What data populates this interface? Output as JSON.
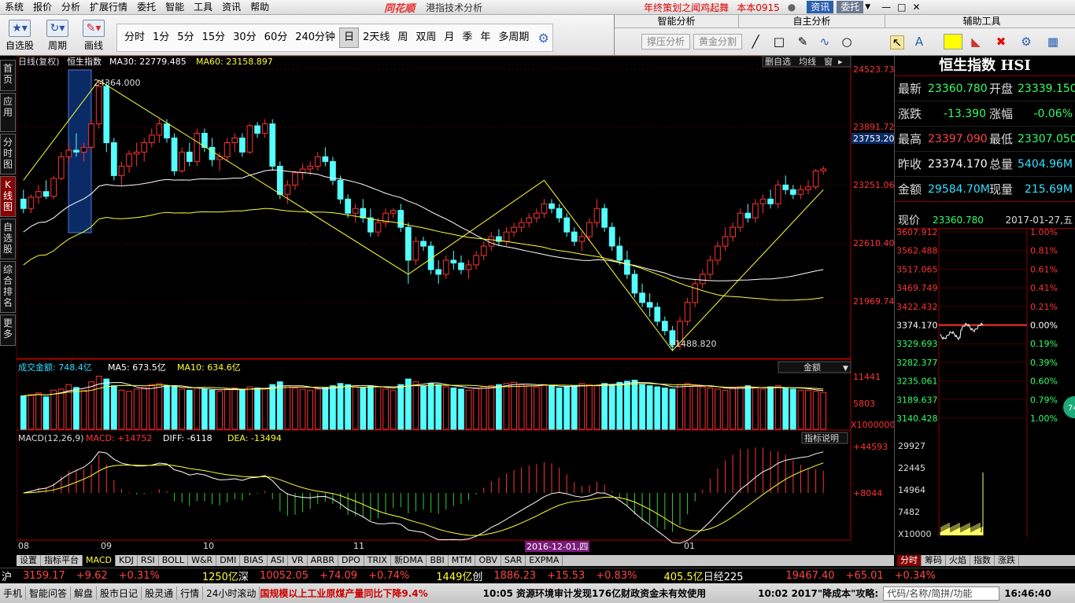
{
  "menu": {
    "items": [
      "系统",
      "报价",
      "分析",
      "扩展行情",
      "委托",
      "智能",
      "工具",
      "资讯",
      "帮助"
    ],
    "logo": "同花顺",
    "title": "港指技术分析",
    "promo": "年终策划之闻鸡起舞",
    "user": "本本0915",
    "btn_info": "资讯",
    "btn_trade": "委托"
  },
  "toolbar": {
    "btn_selfselect": "自选股",
    "btn_cycle": "周期",
    "btn_draw": "画线",
    "periods": [
      "分时",
      "1分",
      "5分",
      "15分",
      "30分",
      "60分",
      "240分钟",
      "日",
      "2天线",
      "周",
      "双周",
      "月",
      "季",
      "年",
      "多周期"
    ],
    "active_period": "日"
  },
  "smart": {
    "title_smart": "智能分析",
    "title_self": "自主分析",
    "title_aux": "辅助工具",
    "btn_pressure": "撑压分析",
    "btn_gold": "黄金分割"
  },
  "leftnav": [
    "首页",
    "应用",
    "分时图",
    "K线图",
    "自选股",
    "综合排名",
    "更多"
  ],
  "chart": {
    "header": {
      "period": "日线(复权)",
      "name": "恒生指数",
      "ma30_label": "MA30: 22779.485",
      "ma60_label": "MA60: 23158.897"
    },
    "buttons": [
      "删自选",
      "均线",
      "窗"
    ],
    "price_axis": [
      "24523.73",
      "23891.72",
      "23753.20",
      "23251.06",
      "22610.40",
      "21969.74"
    ],
    "annot_high": "24364.000",
    "annot_low": "21488.820",
    "vol_header": {
      "label": "成交金额: 748.4亿",
      "ma5": "MA5: 673.5亿",
      "ma10": "MA10: 634.6亿"
    },
    "vol_select": "金额",
    "vol_axis": [
      "11441",
      "5803",
      "X1000000"
    ],
    "macd_header": {
      "label": "MACD(12,26,9)",
      "macd": "MACD: +14752",
      "diff": "DIFF: -6118",
      "dea": "DEA: -13494"
    },
    "macd_btn": "指标说明",
    "macd_axis": [
      "+44593",
      "+8044"
    ],
    "x_labels": [
      "08",
      "09",
      "10",
      "11",
      "2016-12-01,四",
      "01"
    ]
  },
  "chart_data": {
    "type": "candlestick",
    "title": "恒生指数",
    "ohlc": [
      [
        23100,
        23200,
        22950,
        23000
      ],
      [
        23000,
        23150,
        22950,
        23120
      ],
      [
        23120,
        23250,
        23050,
        23180
      ],
      [
        23180,
        23300,
        23100,
        23130
      ],
      [
        23130,
        23350,
        23100,
        23320
      ],
      [
        23320,
        23600,
        23300,
        23550
      ],
      [
        23550,
        23700,
        23480,
        23620
      ],
      [
        23620,
        23800,
        23550,
        23600
      ],
      [
        23600,
        23700,
        23500,
        23650
      ],
      [
        23650,
        23950,
        23600,
        23900
      ],
      [
        23900,
        24364,
        23850,
        24300
      ],
      [
        24300,
        24350,
        23600,
        23700
      ],
      [
        23700,
        23750,
        23300,
        23350
      ],
      [
        23350,
        23500,
        23250,
        23450
      ],
      [
        23450,
        23620,
        23380,
        23580
      ],
      [
        23580,
        23700,
        23450,
        23600
      ],
      [
        23600,
        23750,
        23500,
        23700
      ],
      [
        23700,
        23850,
        23650,
        23780
      ],
      [
        23780,
        23950,
        23700,
        23900
      ],
      [
        23900,
        23950,
        23700,
        23750
      ],
      [
        23750,
        23800,
        23350,
        23400
      ],
      [
        23400,
        23650,
        23380,
        23600
      ],
      [
        23600,
        23700,
        23450,
        23500
      ],
      [
        23500,
        23850,
        23450,
        23800
      ],
      [
        23800,
        23850,
        23600,
        23650
      ],
      [
        23650,
        23750,
        23450,
        23520
      ],
      [
        23520,
        23600,
        23400,
        23550
      ],
      [
        23550,
        23750,
        23500,
        23700
      ],
      [
        23700,
        23800,
        23600,
        23750
      ],
      [
        23750,
        23800,
        23550,
        23600
      ],
      [
        23600,
        23900,
        23580,
        23880
      ],
      [
        23880,
        23920,
        23750,
        23800
      ],
      [
        23800,
        23950,
        23750,
        23900
      ],
      [
        23900,
        23950,
        23400,
        23450
      ],
      [
        23450,
        23500,
        23100,
        23150
      ],
      [
        23150,
        23300,
        23050,
        23250
      ],
      [
        23250,
        23400,
        23200,
        23380
      ],
      [
        23380,
        23480,
        23300,
        23420
      ],
      [
        23420,
        23500,
        23350,
        23450
      ],
      [
        23450,
        23600,
        23400,
        23550
      ],
      [
        23550,
        23650,
        23450,
        23500
      ],
      [
        23500,
        23550,
        23250,
        23300
      ],
      [
        23300,
        23350,
        23050,
        23100
      ],
      [
        23100,
        23150,
        22900,
        22950
      ],
      [
        22950,
        23050,
        22850,
        23000
      ],
      [
        23000,
        23100,
        22850,
        22900
      ],
      [
        22900,
        23000,
        22700,
        22750
      ],
      [
        22750,
        22900,
        22700,
        22850
      ],
      [
        22850,
        23000,
        22800,
        22950
      ],
      [
        22950,
        23000,
        22900,
        22980
      ],
      [
        22980,
        23050,
        22750,
        22800
      ],
      [
        22800,
        22850,
        22200,
        22450
      ],
      [
        22450,
        22700,
        22400,
        22650
      ],
      [
        22650,
        22700,
        22550,
        22600
      ],
      [
        22600,
        22650,
        22300,
        22350
      ],
      [
        22350,
        22450,
        22200,
        22300
      ],
      [
        22300,
        22500,
        22250,
        22450
      ],
      [
        22450,
        22550,
        22350,
        22420
      ],
      [
        22420,
        22500,
        22300,
        22350
      ],
      [
        22350,
        22450,
        22250,
        22400
      ],
      [
        22400,
        22550,
        22350,
        22500
      ],
      [
        22500,
        22650,
        22450,
        22600
      ],
      [
        22600,
        22750,
        22550,
        22700
      ],
      [
        22700,
        22780,
        22600,
        22650
      ],
      [
        22650,
        22800,
        22600,
        22750
      ],
      [
        22750,
        22850,
        22700,
        22800
      ],
      [
        22800,
        22900,
        22750,
        22850
      ],
      [
        22850,
        22950,
        22800,
        22900
      ],
      [
        22900,
        23000,
        22850,
        22950
      ],
      [
        22950,
        23100,
        22900,
        23050
      ],
      [
        23050,
        23100,
        22950,
        23000
      ],
      [
        23000,
        23050,
        22850,
        22900
      ],
      [
        22900,
        22950,
        22700,
        22750
      ],
      [
        22750,
        22800,
        22600,
        22650
      ],
      [
        22650,
        22750,
        22550,
        22700
      ],
      [
        22700,
        22900,
        22650,
        22850
      ],
      [
        22850,
        23100,
        22800,
        23000
      ],
      [
        23000,
        23050,
        22750,
        22800
      ],
      [
        22800,
        22850,
        22550,
        22600
      ],
      [
        22600,
        22700,
        22400,
        22450
      ],
      [
        22450,
        22550,
        22250,
        22300
      ],
      [
        22300,
        22350,
        22050,
        22100
      ],
      [
        22100,
        22200,
        21950,
        22000
      ],
      [
        22000,
        22100,
        21850,
        21950
      ],
      [
        21950,
        22000,
        21750,
        21800
      ],
      [
        21800,
        21850,
        21650,
        21700
      ],
      [
        21700,
        21750,
        21488,
        21550
      ],
      [
        21550,
        21850,
        21500,
        21800
      ],
      [
        21800,
        22050,
        21750,
        22000
      ],
      [
        22000,
        22250,
        21950,
        22200
      ],
      [
        22200,
        22350,
        22150,
        22300
      ],
      [
        22300,
        22500,
        22250,
        22450
      ],
      [
        22450,
        22650,
        22400,
        22600
      ],
      [
        22600,
        22800,
        22550,
        22700
      ],
      [
        22700,
        22850,
        22650,
        22800
      ],
      [
        22800,
        23000,
        22750,
        22950
      ],
      [
        22950,
        23050,
        22850,
        22900
      ],
      [
        22900,
        23100,
        22850,
        23050
      ],
      [
        23050,
        23150,
        22950,
        23100
      ],
      [
        23100,
        23200,
        23000,
        23050
      ],
      [
        23050,
        23300,
        23000,
        23250
      ],
      [
        23250,
        23350,
        23150,
        23200
      ],
      [
        23200,
        23250,
        23100,
        23150
      ],
      [
        23150,
        23250,
        23100,
        23200
      ],
      [
        23200,
        23300,
        23150,
        23230
      ],
      [
        23230,
        23420,
        23200,
        23400
      ],
      [
        23400,
        23450,
        23360,
        23420
      ]
    ],
    "volume": [
      60,
      62,
      65,
      58,
      70,
      72,
      80,
      75,
      70,
      85,
      95,
      90,
      78,
      70,
      68,
      72,
      75,
      80,
      82,
      78,
      76,
      72,
      70,
      74,
      72,
      70,
      68,
      72,
      74,
      70,
      76,
      74,
      72,
      80,
      85,
      78,
      74,
      72,
      70,
      72,
      74,
      78,
      82,
      80,
      76,
      74,
      78,
      76,
      72,
      70,
      80,
      90,
      85,
      78,
      82,
      80,
      76,
      74,
      72,
      70,
      74,
      76,
      78,
      80,
      82,
      84,
      80,
      78,
      76,
      80,
      78,
      74,
      76,
      78,
      82,
      80,
      78,
      82,
      80,
      84,
      86,
      88,
      80,
      78,
      76,
      74,
      72,
      80,
      82,
      78,
      76,
      74,
      72,
      70,
      74,
      76,
      78,
      74,
      72,
      76,
      78,
      74,
      72,
      70,
      70,
      68,
      66
    ],
    "ylim": [
      21488,
      24523.73
    ],
    "xlabels": [
      "08",
      "09",
      "10",
      "11",
      "2016-12-01,四",
      "01"
    ]
  },
  "quote": {
    "title": "恒生指数 HSI",
    "rows": [
      {
        "l": "最新",
        "v": "23360.780",
        "vc": "green",
        "l2": "开盘",
        "v2": "23339.150",
        "v2c": "green"
      },
      {
        "l": "涨跌",
        "v": "-13.390",
        "vc": "green",
        "l2": "涨幅",
        "v2": "-0.06%",
        "v2c": "green"
      },
      {
        "l": "最高",
        "v": "23397.090",
        "vc": "red",
        "l2": "最低",
        "v2": "23307.050",
        "v2c": "green"
      },
      {
        "l": "昨收",
        "v": "23374.170",
        "vc": "white",
        "l2": "总量",
        "v2": "5404.96M",
        "v2c": "cyan"
      },
      {
        "l": "金额",
        "v": "29584.70M",
        "vc": "cyan",
        "l2": "现量",
        "v2": "215.69M",
        "v2c": "cyan"
      }
    ],
    "now_label": "现价",
    "now_value": "23360.780",
    "date": "2017-01-27,五",
    "mini_left": [
      "3607.912",
      "3562.488",
      "3517.065",
      "3469.749",
      "3422.432",
      "3374.170",
      "3329.693",
      "3282.377",
      "3235.061",
      "3189.637",
      "3140.428"
    ],
    "mini_right": [
      "1.00%",
      "0.81%",
      "0.61%",
      "0.41%",
      "0.21%",
      "0.00%",
      "0.19%",
      "0.39%",
      "0.60%",
      "0.79%",
      "1.00%"
    ],
    "mini_vol": [
      "29927",
      "22445",
      "14964",
      "7482",
      "X10000"
    ],
    "badge": "74"
  },
  "bottom_tabs": [
    "设置",
    "指标平台",
    "MACD",
    "KDJ",
    "RSI",
    "BOLL",
    "W&R",
    "DMI",
    "BIAS",
    "ASI",
    "VR",
    "ARBR",
    "DPO",
    "TRIX",
    "新DMA",
    "BBI",
    "MTM",
    "OBV",
    "SAR",
    "EXPMA"
  ],
  "bottom_active": "MACD",
  "rp_tabs": [
    "分时",
    "筹码",
    "火焰",
    "指数",
    "涨跌"
  ],
  "rp_active": "分时",
  "indexbar": {
    "sh_label": "沪",
    "sh_val": "3159.17",
    "sh_chg": "+9.62",
    "sh_pct": "+0.31%",
    "sh_amt": "1250亿",
    "sz_label": "深",
    "sz_val": "10052.05",
    "sz_chg": "+74.09",
    "sz_pct": "+0.74%",
    "cy_amt": "1449亿",
    "cy_label": "创",
    "cy_val": "1886.23",
    "cy_chg": "+15.53",
    "cy_pct": "+0.83%",
    "hs_amt": "405.5亿",
    "hs_label": "日经225",
    "hs_val": "19467.40",
    "hs_chg": "+65.01",
    "hs_pct": "+0.34%"
  },
  "statusbar": {
    "items": [
      "手机",
      "智能问答",
      "解盘",
      "股市日记",
      "股灵通",
      "行情",
      "24小时滚动"
    ],
    "news1": "国规模以上工业原煤产量同比下降9.4%",
    "news2": "10:05 资源环境审计发现176亿财政资金未有效使用",
    "news3": "10:02 2017\"降成本\"攻略:",
    "search": "代码/名称/简拼/功能",
    "clock": "16:46:40"
  }
}
